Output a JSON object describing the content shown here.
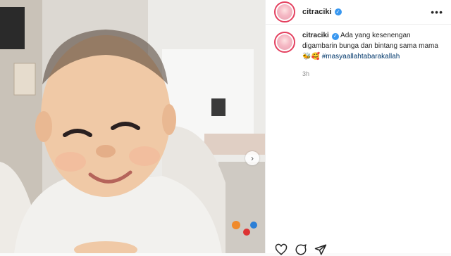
{
  "post": {
    "username": "citraciki",
    "verified_icon": "verified-badge-icon",
    "more_icon": "more-options-icon",
    "next_icon": "chevron-right-icon"
  },
  "caption": {
    "username": "citraciki",
    "text": "Ada yang kesenengan digambarin bunga dan bintang sama mama",
    "emojis": "🐝🥰",
    "hashtag": "#masyaallahtabarakallah",
    "time": "3h"
  },
  "actions": {
    "like_icon": "heart-icon",
    "comment_icon": "comment-icon",
    "share_icon": "share-icon"
  },
  "colors": {
    "accent_ring": "#e4405f",
    "verified": "#3897f0",
    "hashtag": "#00376b"
  }
}
